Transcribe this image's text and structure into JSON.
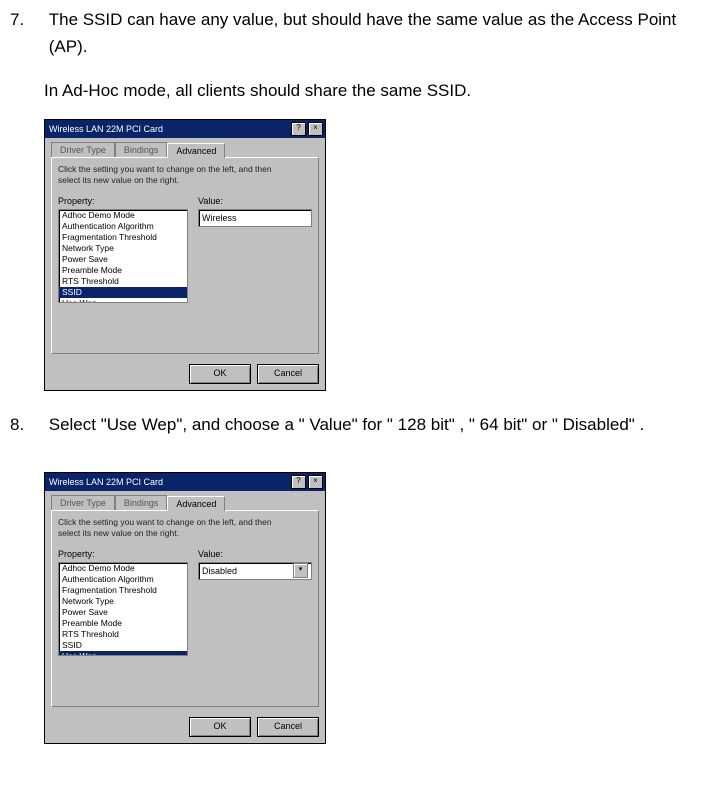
{
  "steps": {
    "7": {
      "num": "7.",
      "text": "The SSID can have any value, but should have the same value as the Access Point (AP).",
      "text2": "In Ad-Hoc mode, all clients should share the same SSID."
    },
    "8": {
      "num": "8.",
      "text": "Select \"Use Wep\", and choose a \" Value\"  for \" 128 bit\" , \" 64 bit\"  or \" Disabled\" ."
    }
  },
  "dlg": {
    "title": "Wireless LAN 22M PCI Card",
    "help": "?",
    "close": "×",
    "tabs": [
      "Driver Type",
      "Bindings",
      "Advanced"
    ],
    "hint1": "Click the setting you want to change on the left, and then",
    "hint2": "select its new value on the right.",
    "labels": {
      "property": "Property:",
      "value": "Value:"
    },
    "props": [
      "Adhoc Demo Mode",
      "Authentication Algorithm",
      "Fragmentation Threshold",
      "Network Type",
      "Power Save",
      "Preamble Mode",
      "RTS Threshold",
      "SSID",
      "Use Wep"
    ],
    "sel1": 7,
    "val1": "Wireless",
    "sel2": 8,
    "val2": "Disabled",
    "ok": "OK",
    "cancel": "Cancel"
  }
}
